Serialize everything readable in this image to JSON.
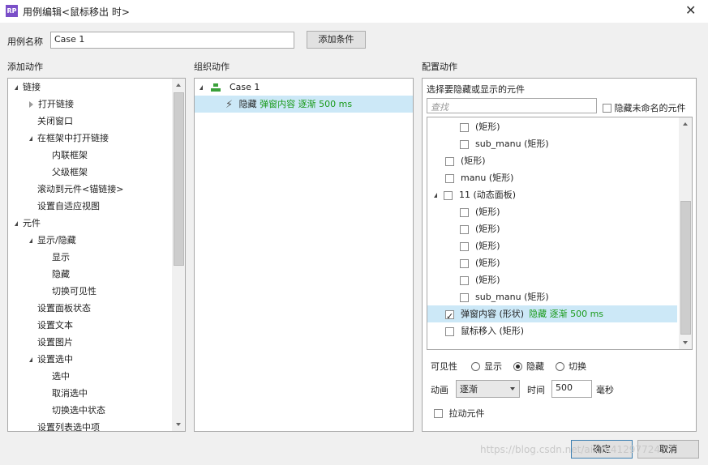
{
  "window": {
    "icon_label": "RP",
    "title": "用例编辑<鼠标移出 时>",
    "close_glyph": "✕"
  },
  "case_name": {
    "label": "用例名称",
    "value": "Case 1",
    "add_condition_button": "添加条件"
  },
  "sections": {
    "add_action": "添加动作",
    "organize_action": "组织动作",
    "configure_action": "配置动作"
  },
  "add_action_tree": [
    {
      "label": "链接",
      "level": 0,
      "toggle": "open"
    },
    {
      "label": "打开链接",
      "level": 1,
      "toggle": "closed"
    },
    {
      "label": "关闭窗口",
      "level": 1,
      "toggle": "none"
    },
    {
      "label": "在框架中打开链接",
      "level": 1,
      "toggle": "open"
    },
    {
      "label": "内联框架",
      "level": 2,
      "toggle": "none"
    },
    {
      "label": "父级框架",
      "level": 2,
      "toggle": "none"
    },
    {
      "label": "滚动到元件<锚链接>",
      "level": 1,
      "toggle": "none"
    },
    {
      "label": "设置自适应视图",
      "level": 1,
      "toggle": "none"
    },
    {
      "label": "元件",
      "level": 0,
      "toggle": "open"
    },
    {
      "label": "显示/隐藏",
      "level": 1,
      "toggle": "open"
    },
    {
      "label": "显示",
      "level": 2,
      "toggle": "none"
    },
    {
      "label": "隐藏",
      "level": 2,
      "toggle": "none"
    },
    {
      "label": "切换可见性",
      "level": 2,
      "toggle": "none"
    },
    {
      "label": "设置面板状态",
      "level": 1,
      "toggle": "none"
    },
    {
      "label": "设置文本",
      "level": 1,
      "toggle": "none"
    },
    {
      "label": "设置图片",
      "level": 1,
      "toggle": "none"
    },
    {
      "label": "设置选中",
      "level": 1,
      "toggle": "open"
    },
    {
      "label": "选中",
      "level": 2,
      "toggle": "none"
    },
    {
      "label": "取消选中",
      "level": 2,
      "toggle": "none"
    },
    {
      "label": "切换选中状态",
      "level": 2,
      "toggle": "none"
    },
    {
      "label": "设置列表选中项",
      "level": 1,
      "toggle": "none"
    }
  ],
  "organize": {
    "case_label": "Case 1",
    "action_name": "隐藏",
    "action_detail": "弹窗内容 逐渐 500 ms"
  },
  "configure": {
    "select_widgets_label": "选择要隐藏或显示的元件",
    "search_placeholder": "查找",
    "hide_unnamed_label": "隐藏未命名的元件",
    "widgets": [
      {
        "name": "",
        "type": "(矩形)",
        "indent": 2,
        "checked": false,
        "toggle": "none",
        "detail": ""
      },
      {
        "name": "sub_manu",
        "type": "(矩形)",
        "indent": 2,
        "checked": false,
        "toggle": "none",
        "detail": ""
      },
      {
        "name": "",
        "type": "(矩形)",
        "indent": 1,
        "checked": false,
        "toggle": "none",
        "detail": ""
      },
      {
        "name": "manu",
        "type": "(矩形)",
        "indent": 1,
        "checked": false,
        "toggle": "none",
        "detail": ""
      },
      {
        "name": "11",
        "type": "(动态面板)",
        "indent": 1,
        "checked": false,
        "toggle": "open",
        "detail": ""
      },
      {
        "name": "",
        "type": "(矩形)",
        "indent": 2,
        "checked": false,
        "toggle": "none",
        "detail": ""
      },
      {
        "name": "",
        "type": "(矩形)",
        "indent": 2,
        "checked": false,
        "toggle": "none",
        "detail": ""
      },
      {
        "name": "",
        "type": "(矩形)",
        "indent": 2,
        "checked": false,
        "toggle": "none",
        "detail": ""
      },
      {
        "name": "",
        "type": "(矩形)",
        "indent": 2,
        "checked": false,
        "toggle": "none",
        "detail": ""
      },
      {
        "name": "",
        "type": "(矩形)",
        "indent": 2,
        "checked": false,
        "toggle": "none",
        "detail": ""
      },
      {
        "name": "sub_manu",
        "type": "(矩形)",
        "indent": 2,
        "checked": false,
        "toggle": "none",
        "detail": ""
      },
      {
        "name": "弹窗内容",
        "type": "(形状)",
        "indent": 1,
        "checked": true,
        "toggle": "none",
        "detail": "隐藏 逐渐 500 ms",
        "selected": true
      },
      {
        "name": "鼠标移入",
        "type": "(矩形)",
        "indent": 1,
        "checked": false,
        "toggle": "none",
        "detail": ""
      }
    ],
    "visibility_label": "可见性",
    "visibility_options": [
      "显示",
      "隐藏",
      "切换"
    ],
    "visibility_selected": "隐藏",
    "animation_label": "动画",
    "animation_value": "逐渐",
    "time_label": "时间",
    "time_value": "500",
    "time_unit": "毫秒",
    "drag_widgets_label": "拉动元件"
  },
  "footer": {
    "ok_button": "确定",
    "cancel_button": "取消",
    "watermark": "https://blog.csdn.net/aixin.41297724"
  }
}
